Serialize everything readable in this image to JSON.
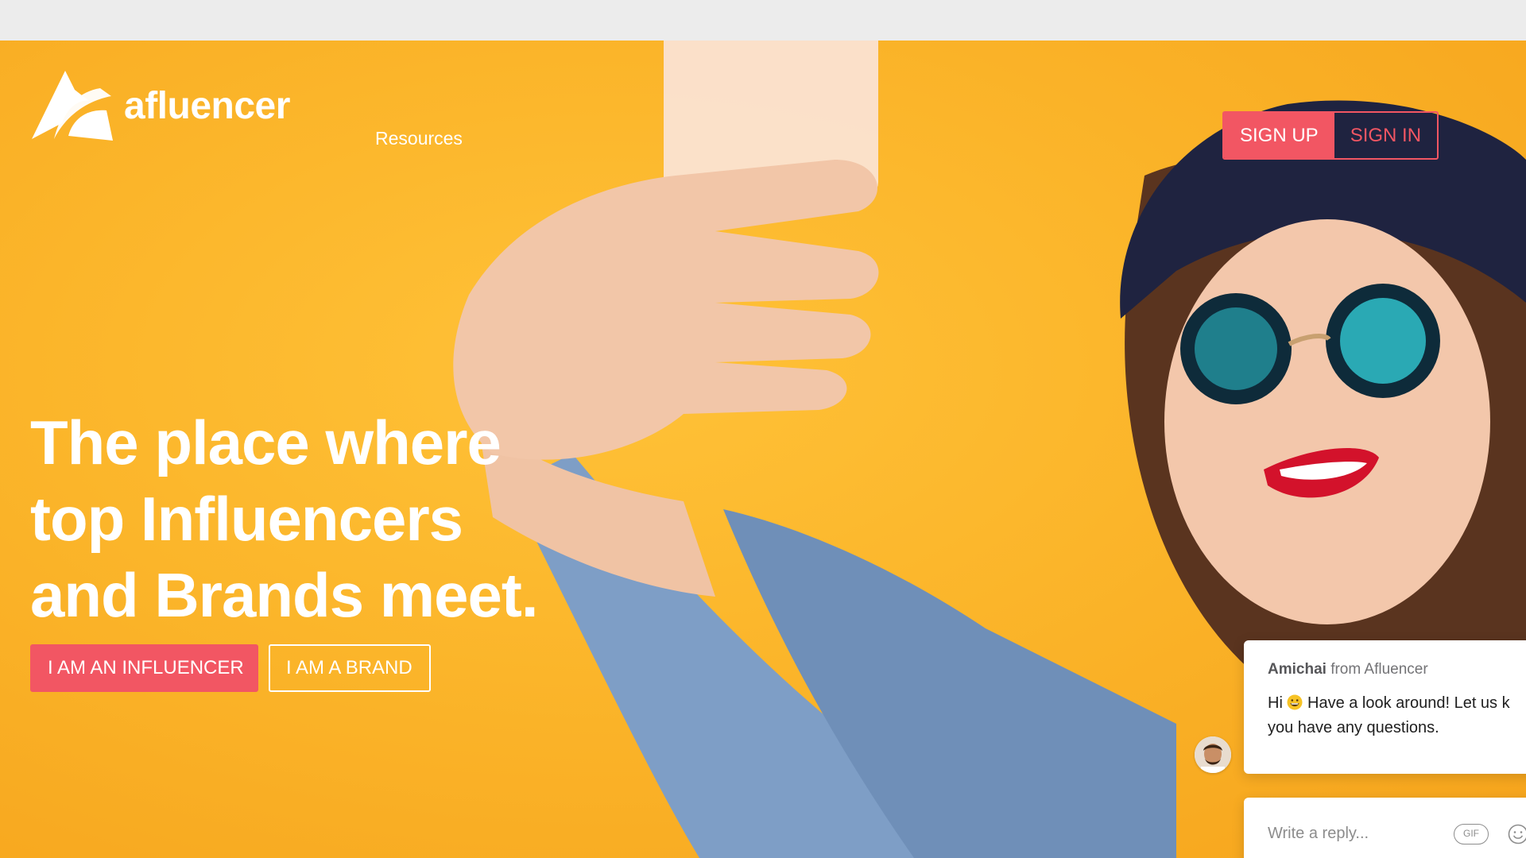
{
  "brand": {
    "name": "afluencer",
    "icon": "afluencer-logo-icon"
  },
  "nav": {
    "resources": "Resources"
  },
  "auth": {
    "signup": "SIGN UP",
    "signin": "SIGN IN"
  },
  "hero": {
    "headline_lines": [
      "The place where",
      "top Influencers",
      "and Brands meet."
    ],
    "cta_influencer": "I AM AN INFLUENCER",
    "cta_brand": "I AM A BRAND"
  },
  "chat": {
    "sender_name": "Amichai",
    "sender_suffix": " from Afluencer",
    "message_start": "Hi ",
    "message_rest": " Have a look around! Let us k",
    "message_line2": "you have any questions.",
    "reply_placeholder": "Write a reply...",
    "gif_label": "GIF"
  },
  "colors": {
    "accent": "#f25663",
    "hero_background": "#fbb52a",
    "text_on_hero": "#ffffff"
  }
}
